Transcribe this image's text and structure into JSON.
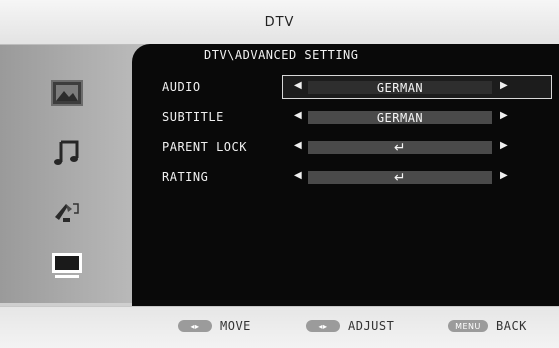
{
  "header": {
    "title": "DTV"
  },
  "sidebar": {
    "items": [
      {
        "name": "photo-icon"
      },
      {
        "name": "music-icon"
      },
      {
        "name": "setup-tools-icon"
      },
      {
        "name": "tv-monitor-icon",
        "active": true
      }
    ]
  },
  "menu": {
    "title": "DTV\\ADVANCED SETTING",
    "rows": [
      {
        "label": "AUDIO",
        "value": "GERMAN",
        "selected": true
      },
      {
        "label": "SUBTITLE",
        "value": "GERMAN"
      },
      {
        "label": "PARENT LOCK",
        "value": "↵"
      },
      {
        "label": "RATING",
        "value": "↵"
      }
    ]
  },
  "footer": {
    "move": {
      "key": "◂▸",
      "label": "MOVE"
    },
    "adjust": {
      "key": "◂▸",
      "label": "ADJUST"
    },
    "back": {
      "key": "MENU",
      "label": "BACK"
    }
  }
}
